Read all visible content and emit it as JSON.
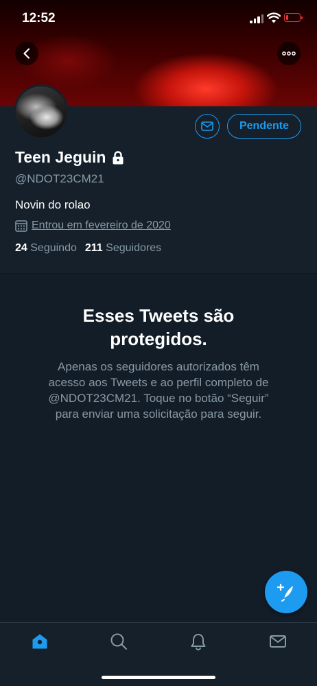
{
  "status_bar": {
    "time": "12:52"
  },
  "profile": {
    "name": "Teen Jeguin",
    "handle": "@NDOT23CM21",
    "bio": "Novin do rolao",
    "joined": "Entrou em fevereiro de 2020",
    "following_count": "24",
    "following_label": "Seguindo",
    "followers_count": "211",
    "followers_label": "Seguidores",
    "follow_button_label": "Pendente"
  },
  "protected_notice": {
    "title_line1": "Esses Tweets são",
    "title_line2": "protegidos.",
    "desc_line1": "Apenas os seguidores autorizados têm",
    "desc_line2": "acesso aos Tweets e ao perfil completo de",
    "desc_line3": "@NDOT23CM21. Toque no botão “Seguir”",
    "desc_line4": "para enviar uma solicitação para seguir."
  },
  "icons": {
    "back": "back-arrow-icon",
    "more": "more-options-icon",
    "message": "envelope-icon",
    "lock": "lock-icon",
    "calendar": "calendar-icon",
    "compose": "compose-tweet-icon",
    "tabs": [
      "home-icon",
      "search-icon",
      "notifications-bell-icon",
      "messages-envelope-icon"
    ]
  },
  "colors": {
    "accent": "#1d9bf0",
    "background": "#15202b",
    "secondary_text": "#8899a6",
    "battery": "#ee3333"
  }
}
